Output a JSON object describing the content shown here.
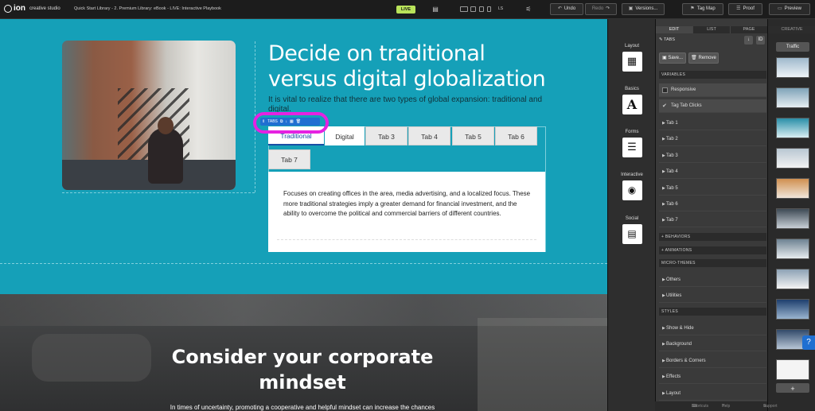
{
  "topbar": {
    "logo_ion": "ion",
    "logo_sub": "creative studio",
    "breadcrumb": "Quick Start Library - 2. Premium Library: eBook - LIVE: Interactive Playbook",
    "live_badge": "LIVE",
    "device_ls": "LS",
    "undo": "Undo",
    "redo": "Redo",
    "versions": "Versions...",
    "tag_map": "Tag Map",
    "proof": "Proof",
    "preview": "Preview"
  },
  "canvas": {
    "hero_title": "Decide on traditional versus digital globalization",
    "hero_intro": "It is vital to realize that there are two types of global expansion: traditional and digital.",
    "tabs_toolbar_label": "TABS",
    "tabs": [
      "Traditional",
      "Digital",
      "Tab 3",
      "Tab 4",
      "Tab 5",
      "Tab 6",
      "Tab 7"
    ],
    "active_tab": "Traditional",
    "tab_content": "Focuses on creating offices in the area, media advertising, and a localized focus. These more traditional strategies imply a greater demand for financial investment, and the ability to overcome the political and commercial barriers of different countries.",
    "section2_title_a": "Consider your ",
    "section2_title_b": "corporate mindset",
    "section2_text": "In times of uncertainty, promoting a cooperative and helpful mindset can increase the chances"
  },
  "widgets": [
    {
      "label": "Layout",
      "icon": "layout-icon"
    },
    {
      "label": "Basics",
      "icon": "text-a-icon",
      "glyph": "A"
    },
    {
      "label": "Forms",
      "icon": "form-icon"
    },
    {
      "label": "Interactive",
      "icon": "play-icon"
    },
    {
      "label": "Social",
      "icon": "chat-icon"
    }
  ],
  "props": {
    "tabs": [
      "EDIT",
      "LIST",
      "PAGE"
    ],
    "title": "TABS",
    "id_btn": "ID",
    "save": "Save...",
    "remove": "Remove",
    "variables_header": "VARIABLES",
    "responsive": "Responsive",
    "tag_tab_clicks": "Tag Tab Clicks",
    "tab_items": [
      "Tab 1",
      "Tab 2",
      "Tab 3",
      "Tab 4",
      "Tab 5",
      "Tab 6",
      "Tab 7"
    ],
    "behaviors": "+ BEHAVIORS",
    "animations": "+ ANIMATIONS",
    "micro_themes": "MICRO-THEMES",
    "others": "Others",
    "utilities": "Utilities",
    "styles": "STYLES",
    "style_items": [
      "Show & Hide",
      "Background",
      "Borders & Corners",
      "Effects",
      "Layout"
    ]
  },
  "creative": {
    "title": "CREATIVE",
    "traffic": "Traffic",
    "add": "+"
  },
  "bottombar": {
    "shortcuts": "Shortcuts",
    "help": "Help center",
    "support": "Support"
  },
  "colors": {
    "canvas_bg": "#15a0b8",
    "highlight": "#e522e1",
    "live": "#b9e35a",
    "accent_blue": "#1f6fd1"
  }
}
